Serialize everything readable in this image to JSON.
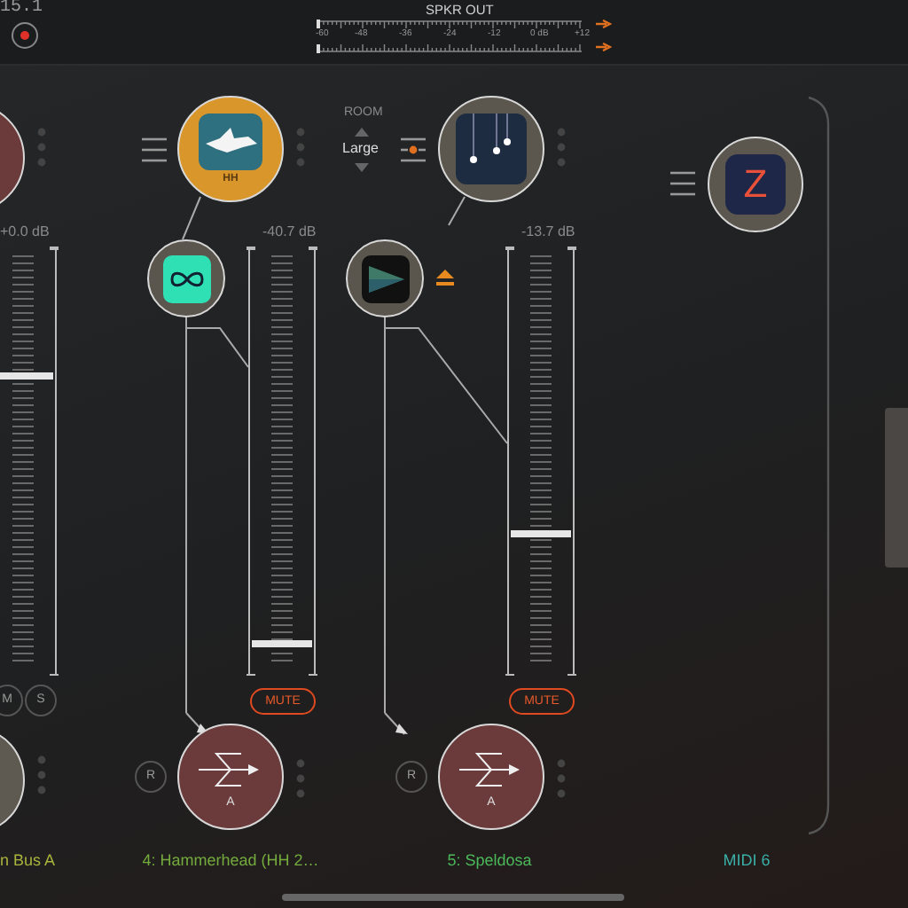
{
  "top_bar": {
    "version": "15.1",
    "meter": {
      "label": "SPKR OUT",
      "ticks": [
        "-60",
        "-48",
        "-36",
        "-24",
        "-12",
        "0 dB",
        "+12"
      ]
    }
  },
  "room": {
    "label": "ROOM",
    "value": "Large"
  },
  "channels": [
    {
      "kind": "bus",
      "name": "n Bus A",
      "color": "#a9b43c",
      "gain": "+0.0 dB",
      "level": 0.7,
      "buttons": [
        "M",
        "S"
      ]
    },
    {
      "kind": "instrument",
      "name": "4: Hammerhead (HH 2…",
      "color": "#74ab3c",
      "plugin_label": "HH",
      "gain": "-40.7 dB",
      "level": 0.07,
      "mute": "MUTE",
      "record": "R",
      "send": "A"
    },
    {
      "kind": "instrument",
      "name": "5: Speldosa",
      "color": "#4bb85a",
      "gain": "-13.7 dB",
      "level": 0.33,
      "mute": "MUTE",
      "record": "R",
      "send": "A"
    },
    {
      "kind": "midi",
      "name": "MIDI 6",
      "color": "#3ab0a8",
      "plugin_label": "Z"
    }
  ]
}
